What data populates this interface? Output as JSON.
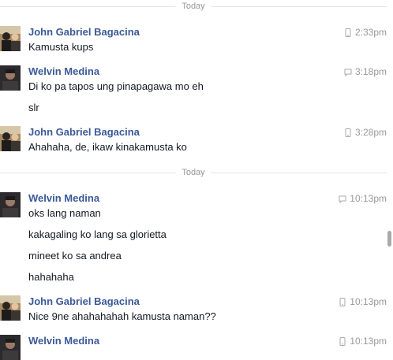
{
  "dividers": [
    "Today",
    "Today"
  ],
  "messages": [
    {
      "sender": "John Gabriel Bagacina",
      "time": "2:33pm",
      "device": "mobile-icon",
      "lines": [
        "Kamusta kups"
      ]
    },
    {
      "sender": "Welvin Medina",
      "time": "3:18pm",
      "device": "chat-icon",
      "lines": [
        "Di ko pa tapos ung pinapagawa mo eh",
        "slr"
      ]
    },
    {
      "sender": "John Gabriel Bagacina",
      "time": "3:28pm",
      "device": "mobile-icon",
      "lines": [
        "Ahahaha, de, ikaw kinakamusta ko"
      ]
    },
    {
      "sender": "Welvin Medina",
      "time": "10:13pm",
      "device": "chat-icon",
      "lines": [
        "oks lang naman",
        "kakagaling ko lang sa glorietta",
        "mineet ko sa andrea",
        "hahahaha"
      ]
    },
    {
      "sender": "John Gabriel Bagacina",
      "time": "10:13pm",
      "device": "mobile-icon",
      "lines": [
        "Nice 9ne ahahahahah kamusta naman??"
      ]
    },
    {
      "sender": "Welvin Medina",
      "time": "10:13pm",
      "device": "mobile-icon",
      "lines": []
    }
  ],
  "colors": {
    "sender": "#3b5998",
    "meta": "#999999",
    "text": "#141823"
  }
}
